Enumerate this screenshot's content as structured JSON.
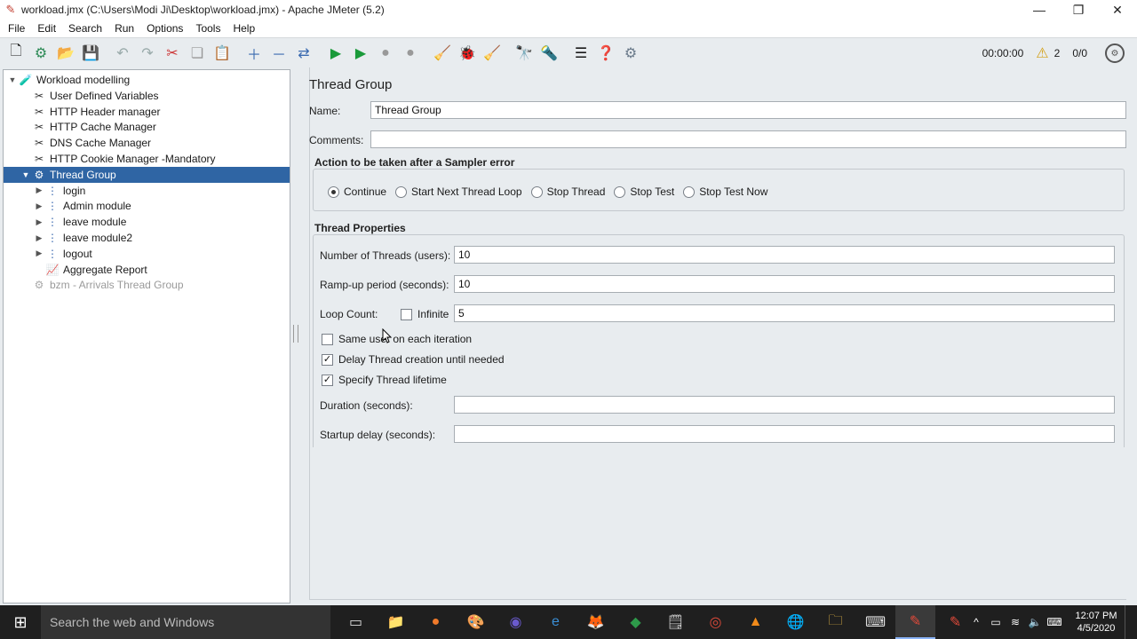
{
  "window": {
    "title": "workload.jmx (C:\\Users\\Modi Ji\\Desktop\\workload.jmx) - Apache JMeter (5.2)",
    "controls": {
      "minimize": "—",
      "restore": "❐",
      "close": "✕"
    }
  },
  "menu": [
    "File",
    "Edit",
    "Search",
    "Run",
    "Options",
    "Tools",
    "Help"
  ],
  "toolbar": {
    "timer": "00:00:00",
    "warnings": "2",
    "threads": "0/0",
    "icons": [
      "new-icon",
      "templates-icon",
      "open-icon",
      "save-icon",
      "undo-icon",
      "redo-icon",
      "cut-icon",
      "copy-icon",
      "paste-icon",
      "expand-icon",
      "collapse-icon",
      "toggle-icon",
      "start-icon",
      "start-no-pause-icon",
      "stop-icon",
      "shutdown-icon",
      "clear-icon",
      "clear-all-icon",
      "clear-broom-icon",
      "search-icon",
      "reset-search-icon",
      "function-helper-icon",
      "help-icon",
      "remote-icon"
    ]
  },
  "tree": [
    {
      "label": "Workload modelling",
      "level": 0,
      "toggle": "▼",
      "icon": "test-plan-icon",
      "selected": false,
      "disabled": false
    },
    {
      "label": "User Defined Variables",
      "level": 1,
      "toggle": "",
      "icon": "config-icon",
      "selected": false,
      "disabled": false
    },
    {
      "label": "HTTP Header manager",
      "level": 1,
      "toggle": "",
      "icon": "config-icon",
      "selected": false,
      "disabled": false
    },
    {
      "label": "HTTP Cache Manager",
      "level": 1,
      "toggle": "",
      "icon": "config-icon",
      "selected": false,
      "disabled": false
    },
    {
      "label": "DNS Cache Manager",
      "level": 1,
      "toggle": "",
      "icon": "config-icon",
      "selected": false,
      "disabled": false
    },
    {
      "label": "HTTP Cookie Manager -Mandatory",
      "level": 1,
      "toggle": "",
      "icon": "config-icon",
      "selected": false,
      "disabled": false
    },
    {
      "label": "Thread Group",
      "level": 1,
      "toggle": "▼",
      "icon": "gear-icon",
      "selected": true,
      "disabled": false
    },
    {
      "label": "login",
      "level": 2,
      "toggle": "▶",
      "icon": "controller-icon",
      "selected": false,
      "disabled": false
    },
    {
      "label": "Admin module",
      "level": 2,
      "toggle": "▶",
      "icon": "controller-icon",
      "selected": false,
      "disabled": false
    },
    {
      "label": "leave module",
      "level": 2,
      "toggle": "▶",
      "icon": "controller-icon",
      "selected": false,
      "disabled": false
    },
    {
      "label": "leave module2",
      "level": 2,
      "toggle": "▶",
      "icon": "controller-icon",
      "selected": false,
      "disabled": false
    },
    {
      "label": "logout",
      "level": 2,
      "toggle": "▶",
      "icon": "controller-icon",
      "selected": false,
      "disabled": false
    },
    {
      "label": "Aggregate Report",
      "level": 2,
      "toggle": "",
      "icon": "report-icon",
      "selected": false,
      "disabled": false
    },
    {
      "label": "bzm - Arrivals Thread Group",
      "level": 1,
      "toggle": "",
      "icon": "gear-icon",
      "selected": false,
      "disabled": true
    }
  ],
  "panel": {
    "title": "Thread Group",
    "name_label": "Name:",
    "name_value": "Thread Group",
    "comments_label": "Comments:",
    "comments_value": "",
    "sampler_error": {
      "title": "Action to be taken after a Sampler error",
      "options": [
        "Continue",
        "Start Next Thread Loop",
        "Stop Thread",
        "Stop Test",
        "Stop Test Now"
      ],
      "selected": "Continue"
    },
    "thread_properties": {
      "title": "Thread Properties",
      "threads_label": "Number of Threads (users):",
      "threads_value": "10",
      "rampup_label": "Ramp-up period (seconds):",
      "rampup_value": "10",
      "loop_label": "Loop Count:",
      "infinite_label": "Infinite",
      "infinite_checked": false,
      "loop_value": "5",
      "same_user_label": "Same user on each iteration",
      "same_user_checked": false,
      "delay_label": "Delay Thread creation until needed",
      "delay_checked": true,
      "lifetime_label": "Specify Thread lifetime",
      "lifetime_checked": true,
      "duration_label": "Duration (seconds):",
      "duration_value": "",
      "startup_label": "Startup delay (seconds):",
      "startup_value": ""
    }
  },
  "taskbar": {
    "search_placeholder": "Search the web and Windows",
    "time": "12:07 PM",
    "date": "4/5/2020"
  }
}
